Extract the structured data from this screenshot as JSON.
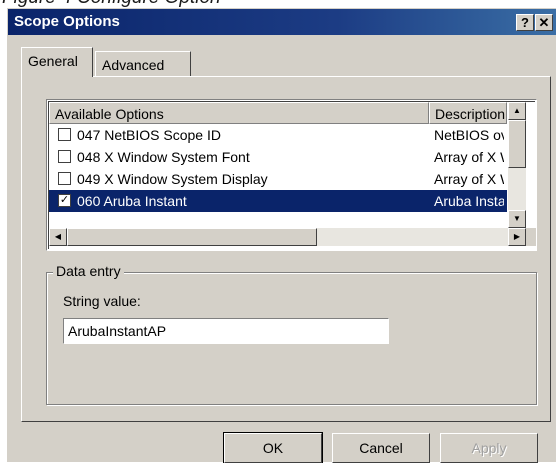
{
  "caption": "Figure 4 Configure Option",
  "window": {
    "title": "Scope Options",
    "help_label": "?",
    "close_label": "✕"
  },
  "tabs": [
    {
      "label": "General",
      "active": true
    },
    {
      "label": "Advanced",
      "active": false
    }
  ],
  "options_list": {
    "columns": [
      "Available Options",
      "Description"
    ],
    "rows": [
      {
        "checked": false,
        "name": "047 NetBIOS Scope ID",
        "description": "NetBIOS ov",
        "selected": false
      },
      {
        "checked": false,
        "name": "048 X Window System Font",
        "description": "Array of X W",
        "selected": false
      },
      {
        "checked": false,
        "name": "049 X Window System Display",
        "description": "Array of X W",
        "selected": false
      },
      {
        "checked": true,
        "name": "060 Aruba Instant",
        "description": "Aruba Instar",
        "selected": true
      }
    ],
    "vertical_scroll_position": 0.0
  },
  "data_entry": {
    "group_title": "Data entry",
    "field_label": "String value:",
    "field_value": "ArubaInstantAP"
  },
  "buttons": {
    "ok": "OK",
    "cancel": "Cancel",
    "apply": "Apply"
  },
  "colors": {
    "titlebar": "#0a246a",
    "selection": "#0a246a",
    "face": "#d4d0c8"
  }
}
